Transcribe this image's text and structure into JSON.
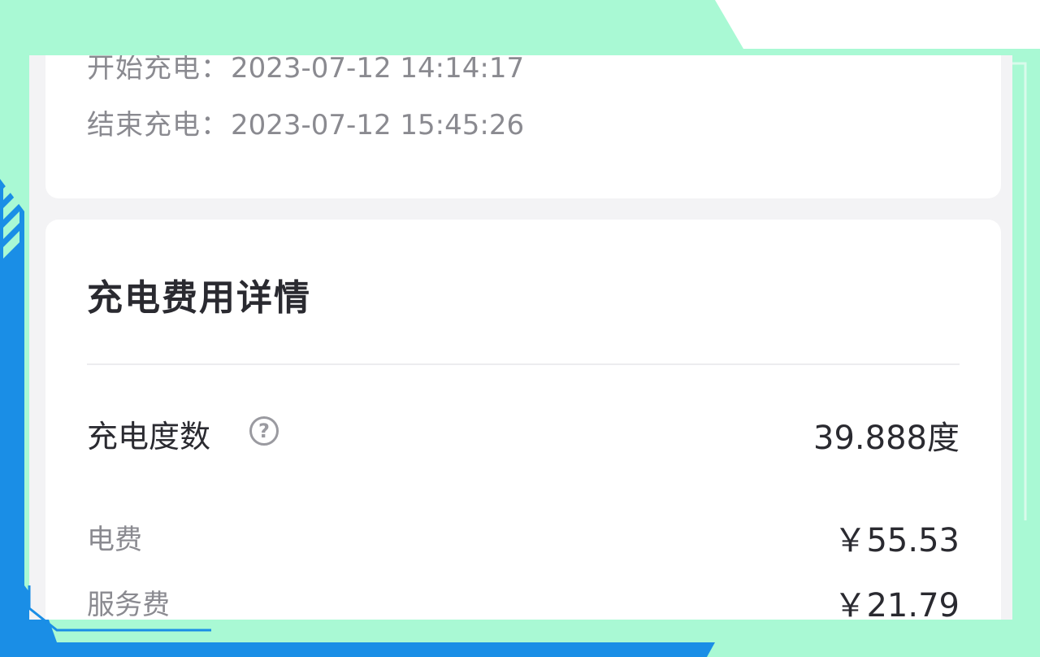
{
  "colors": {
    "mint": "#a9f9d4",
    "blue": "#1a8ee6",
    "panel_bg": "#f3f3f5",
    "card_bg": "#ffffff",
    "text_dark": "#2a2a30",
    "text_gray": "#8a8a90"
  },
  "charge_times": {
    "start": {
      "label": "开始充电：",
      "value": "2023-07-12 14:14:17"
    },
    "end": {
      "label": "结束充电：",
      "value": "2023-07-12 15:45:26"
    }
  },
  "fee_details": {
    "title": "充电费用详情",
    "kwh": {
      "label": "充电度数",
      "value": "39.888度",
      "help_icon": "help-circle-icon",
      "help_glyph": "?"
    },
    "items": [
      {
        "label": "电费",
        "value": "￥55.53"
      },
      {
        "label": "服务费",
        "value": "￥21.79"
      }
    ]
  }
}
